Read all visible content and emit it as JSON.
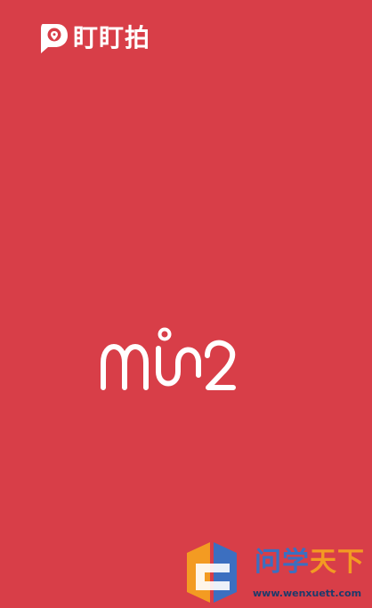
{
  "app": {
    "brand_name": "盯盯拍",
    "product_name": "min2",
    "icon": "camera-pin-icon",
    "background_color": "#d83e48"
  },
  "watermark": {
    "title_part1": "问学",
    "title_part2": "天下",
    "url": "www.wenxuett.com",
    "colors": {
      "blue": "#3c6fc0",
      "orange": "#f39b22"
    }
  }
}
